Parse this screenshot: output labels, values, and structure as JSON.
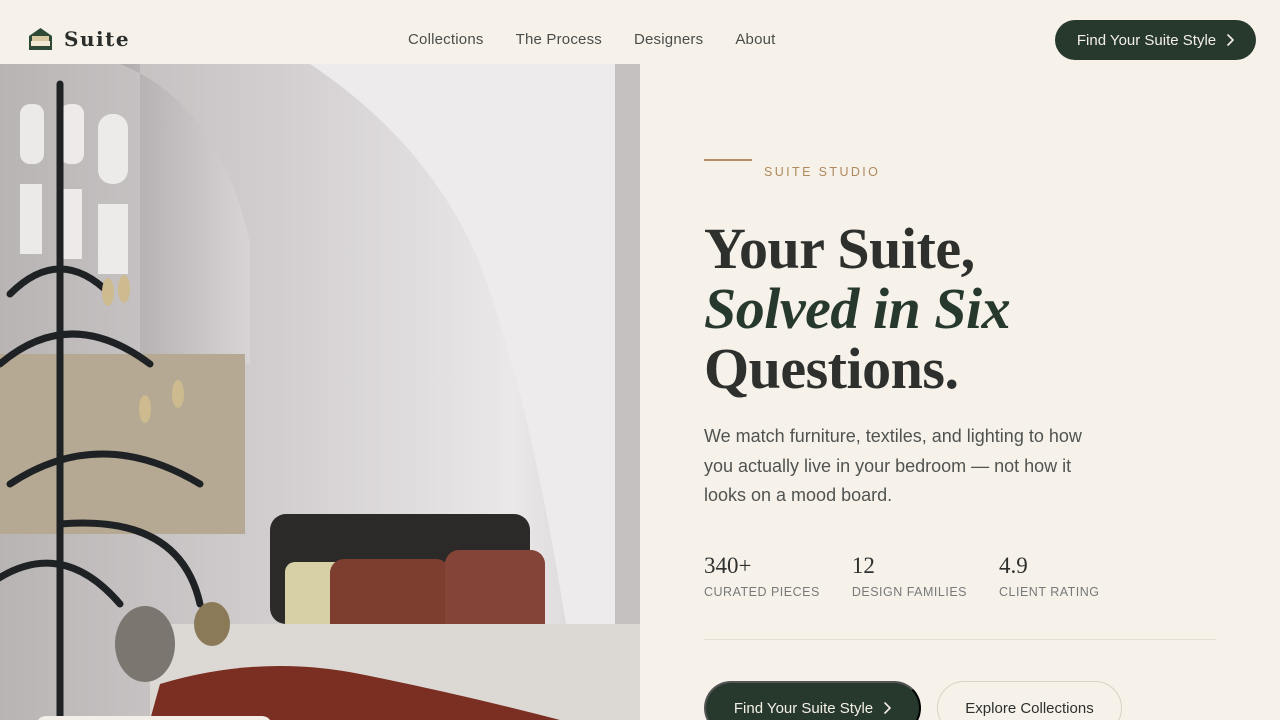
{
  "brand": {
    "name": "Suite",
    "icon": "bed-icon"
  },
  "nav": {
    "items": [
      "Collections",
      "The Process",
      "Designers",
      "About"
    ]
  },
  "header_cta": {
    "label": "Find Your Suite Style",
    "icon": "chevron-right-icon"
  },
  "hero": {
    "eyebrow": "SUITE STUDIO",
    "headline_line1": "Your Suite,",
    "headline_line2": "Solved in Six",
    "headline_line3": "Questions.",
    "lede": "We match furniture, textiles, and lighting to how you actually live in your bedroom — not how it looks on a mood board.",
    "stats": [
      {
        "value": "340+",
        "label": "CURATED PIECES"
      },
      {
        "value": "12",
        "label": "DESIGN FAMILIES"
      },
      {
        "value": "4.9",
        "label": "CLIENT RATING"
      }
    ],
    "primary_cta": "Find Your Suite Style",
    "secondary_cta": "Explore Collections"
  },
  "colors": {
    "background": "#f6f2ea",
    "accent_green": "#27392d",
    "accent_gold": "#b0895d",
    "text": "#2e302e"
  }
}
